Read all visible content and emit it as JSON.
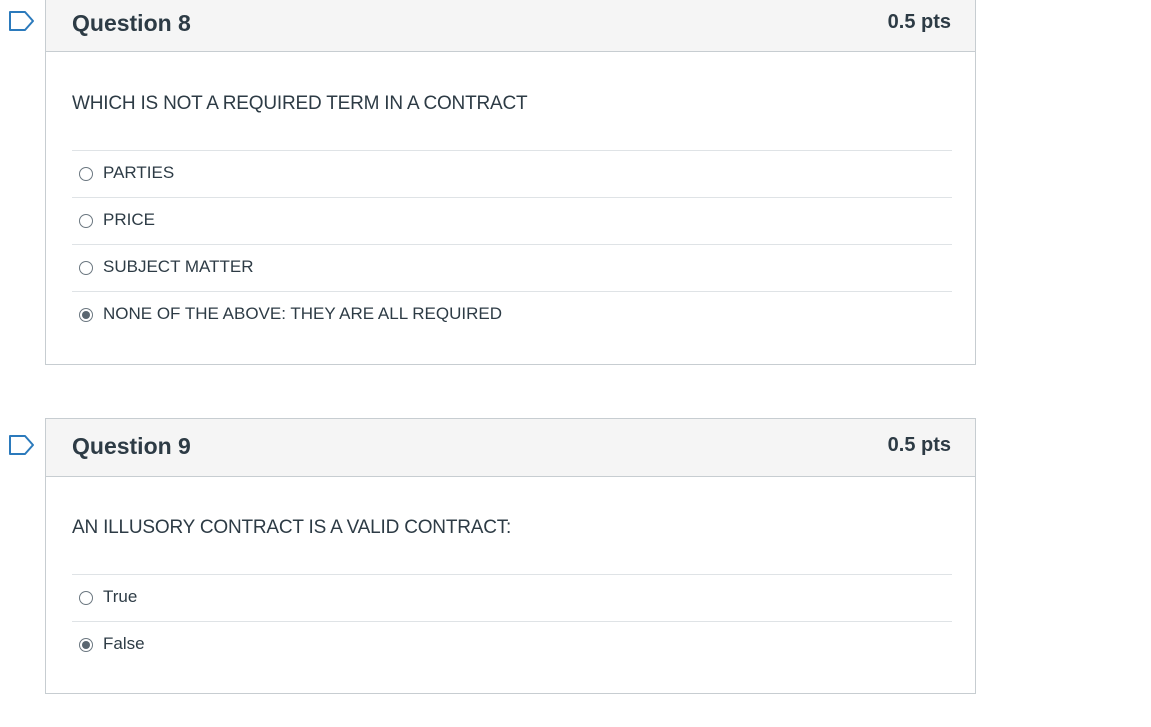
{
  "questions": [
    {
      "title": "Question 8",
      "points": "0.5 pts",
      "text": "WHICH IS NOT A REQUIRED TERM IN A CONTRACT",
      "answers": [
        {
          "label": "PARTIES",
          "selected": false
        },
        {
          "label": "PRICE",
          "selected": false
        },
        {
          "label": "SUBJECT MATTER",
          "selected": false
        },
        {
          "label": "NONE OF THE ABOVE: THEY ARE ALL REQUIRED",
          "selected": true
        }
      ]
    },
    {
      "title": "Question 9",
      "points": "0.5 pts",
      "text": "AN ILLUSORY CONTRACT IS A VALID CONTRACT:",
      "answers": [
        {
          "label": "True",
          "selected": false
        },
        {
          "label": "False",
          "selected": true
        }
      ]
    }
  ],
  "colors": {
    "flag_outline": "#2b7abc",
    "header_bg": "#f5f5f5",
    "border": "#c7cdd1",
    "text": "#2d3b45"
  },
  "icons": {
    "flag": "bookmark-flag-icon",
    "radio": "radio-button"
  }
}
